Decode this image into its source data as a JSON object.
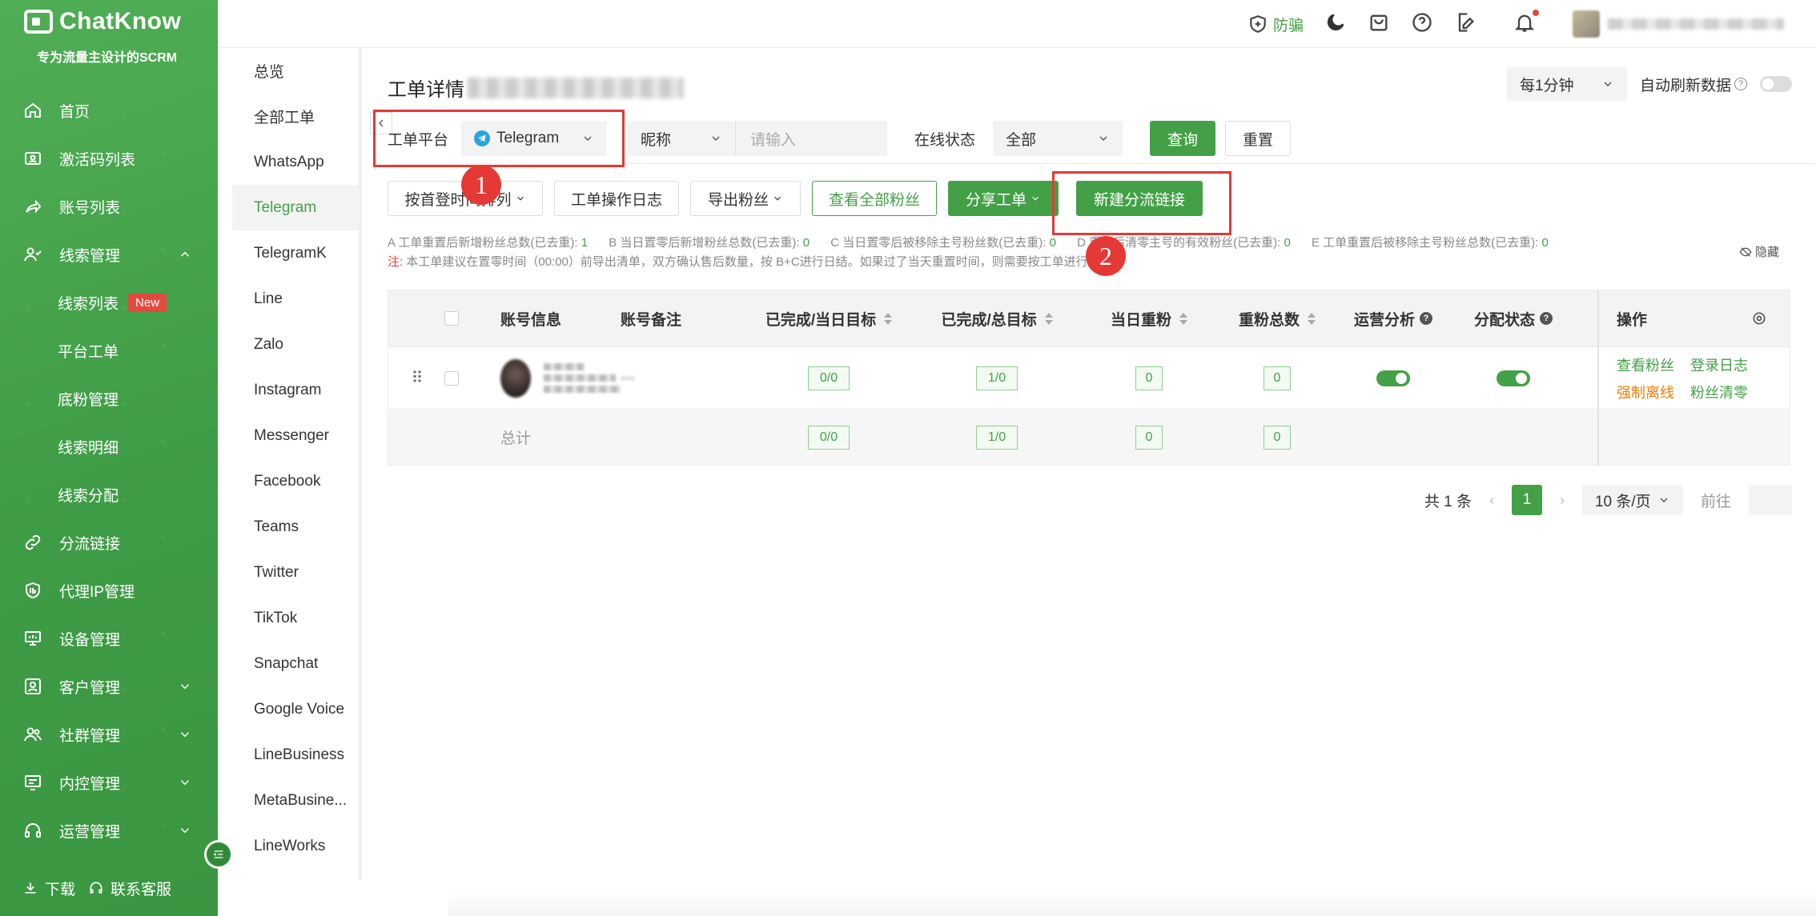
{
  "brand": {
    "name": "ChatKnow",
    "tagline": "专为流量主设计的SCRM"
  },
  "sidebar": {
    "items": [
      {
        "label": "首页",
        "icon": "home-icon"
      },
      {
        "label": "激活码列表",
        "icon": "id-card-icon"
      },
      {
        "label": "账号列表",
        "icon": "share-icon"
      },
      {
        "label": "线索管理",
        "icon": "users-icon",
        "expanded": true
      }
    ],
    "sub_items": [
      {
        "label": "线索列表",
        "badge": "New"
      },
      {
        "label": "平台工单"
      },
      {
        "label": "底粉管理"
      },
      {
        "label": "线索明细"
      },
      {
        "label": "线索分配"
      }
    ],
    "items_after": [
      {
        "label": "分流链接",
        "icon": "link-icon"
      },
      {
        "label": "代理IP管理",
        "icon": "ip-icon"
      },
      {
        "label": "设备管理",
        "icon": "monitor-icon"
      },
      {
        "label": "客户管理",
        "icon": "customer-icon"
      },
      {
        "label": "社群管理",
        "icon": "group-icon"
      },
      {
        "label": "内控管理",
        "icon": "control-icon"
      },
      {
        "label": "运营管理",
        "icon": "headset-icon"
      }
    ],
    "footer": {
      "download": "下载",
      "support": "联系客服"
    }
  },
  "topbar": {
    "anti_fraud": "防骗"
  },
  "subnav": {
    "items": [
      "总览",
      "全部工单",
      "WhatsApp",
      "Telegram",
      "TelegramK",
      "Line",
      "Zalo",
      "Instagram",
      "Messenger",
      "Facebook",
      "Teams",
      "Twitter",
      "TikTok",
      "Snapchat",
      "Google Voice",
      "LineBusiness",
      "MetaBusine...",
      "LineWorks"
    ],
    "active": "Telegram"
  },
  "page": {
    "title": "工单详情",
    "refresh_interval": "每1分钟",
    "auto_refresh_label": "自动刷新数据",
    "auto_refresh_on": false
  },
  "filters": {
    "platform_label": "工单平台",
    "platform_value": "Telegram",
    "field_select": "昵称",
    "search_placeholder": "请输入",
    "online_label": "在线状态",
    "online_value": "全部",
    "query_btn": "查询",
    "reset_btn": "重置"
  },
  "actions": {
    "sort_btn": "按首登时间排列",
    "log_btn": "工单操作日志",
    "export_btn": "导出粉丝",
    "view_all_btn": "查看全部粉丝",
    "share_btn": "分享工单",
    "new_link_btn": "新建分流链接"
  },
  "annotations": {
    "badge1": "1",
    "badge2": "2"
  },
  "stats": [
    {
      "label": "A 工单重置后新增粉丝总数(已去重):",
      "value": "1"
    },
    {
      "label": "B 当日置零后新增粉丝总数(已去重):",
      "value": "0"
    },
    {
      "label": "C 当日置零后被移除主号粉丝数(已去重):",
      "value": "0"
    },
    {
      "label": "D 重置后清零主号的有效粉丝(已去重):",
      "value": "0"
    },
    {
      "label": "E 工单重置后被移除主号粉丝总数(已去重):",
      "value": "0"
    }
  ],
  "note": {
    "prefix": "注:",
    "text": "本工单建议在置零时间（00:00）前导出清单，双方确认售后数量，按 B+C进行日结。如果过了当天重置时间，则需要按工单进行统计。"
  },
  "hide_label": "隐藏",
  "table": {
    "headers": {
      "account": "账号信息",
      "remark": "账号备注",
      "done_today": "已完成/当日目标",
      "done_total": "已完成/总目标",
      "dup_today": "当日重粉",
      "dup_total": "重粉总数",
      "ops_analysis": "运营分析",
      "assign_status": "分配状态",
      "actions": "操作"
    },
    "rows": [
      {
        "done_today": "0/0",
        "done_total": "1/0",
        "dup_today": "0",
        "dup_total": "0",
        "ops_analysis_on": true,
        "assign_on": true,
        "links": {
          "view_fans": "查看粉丝",
          "login_log": "登录日志",
          "force_offline": "强制离线",
          "clear_fans": "粉丝清零"
        }
      }
    ],
    "summary": {
      "label": "总计",
      "done_today": "0/0",
      "done_total": "1/0",
      "dup_today": "0",
      "dup_total": "0"
    }
  },
  "pagination": {
    "total": "共 1 条",
    "current": "1",
    "page_size": "10 条/页",
    "goto": "前往"
  },
  "colors": {
    "brand_green": "#43a047",
    "accent_red": "#e53935",
    "warning_orange": "#f57c00"
  }
}
